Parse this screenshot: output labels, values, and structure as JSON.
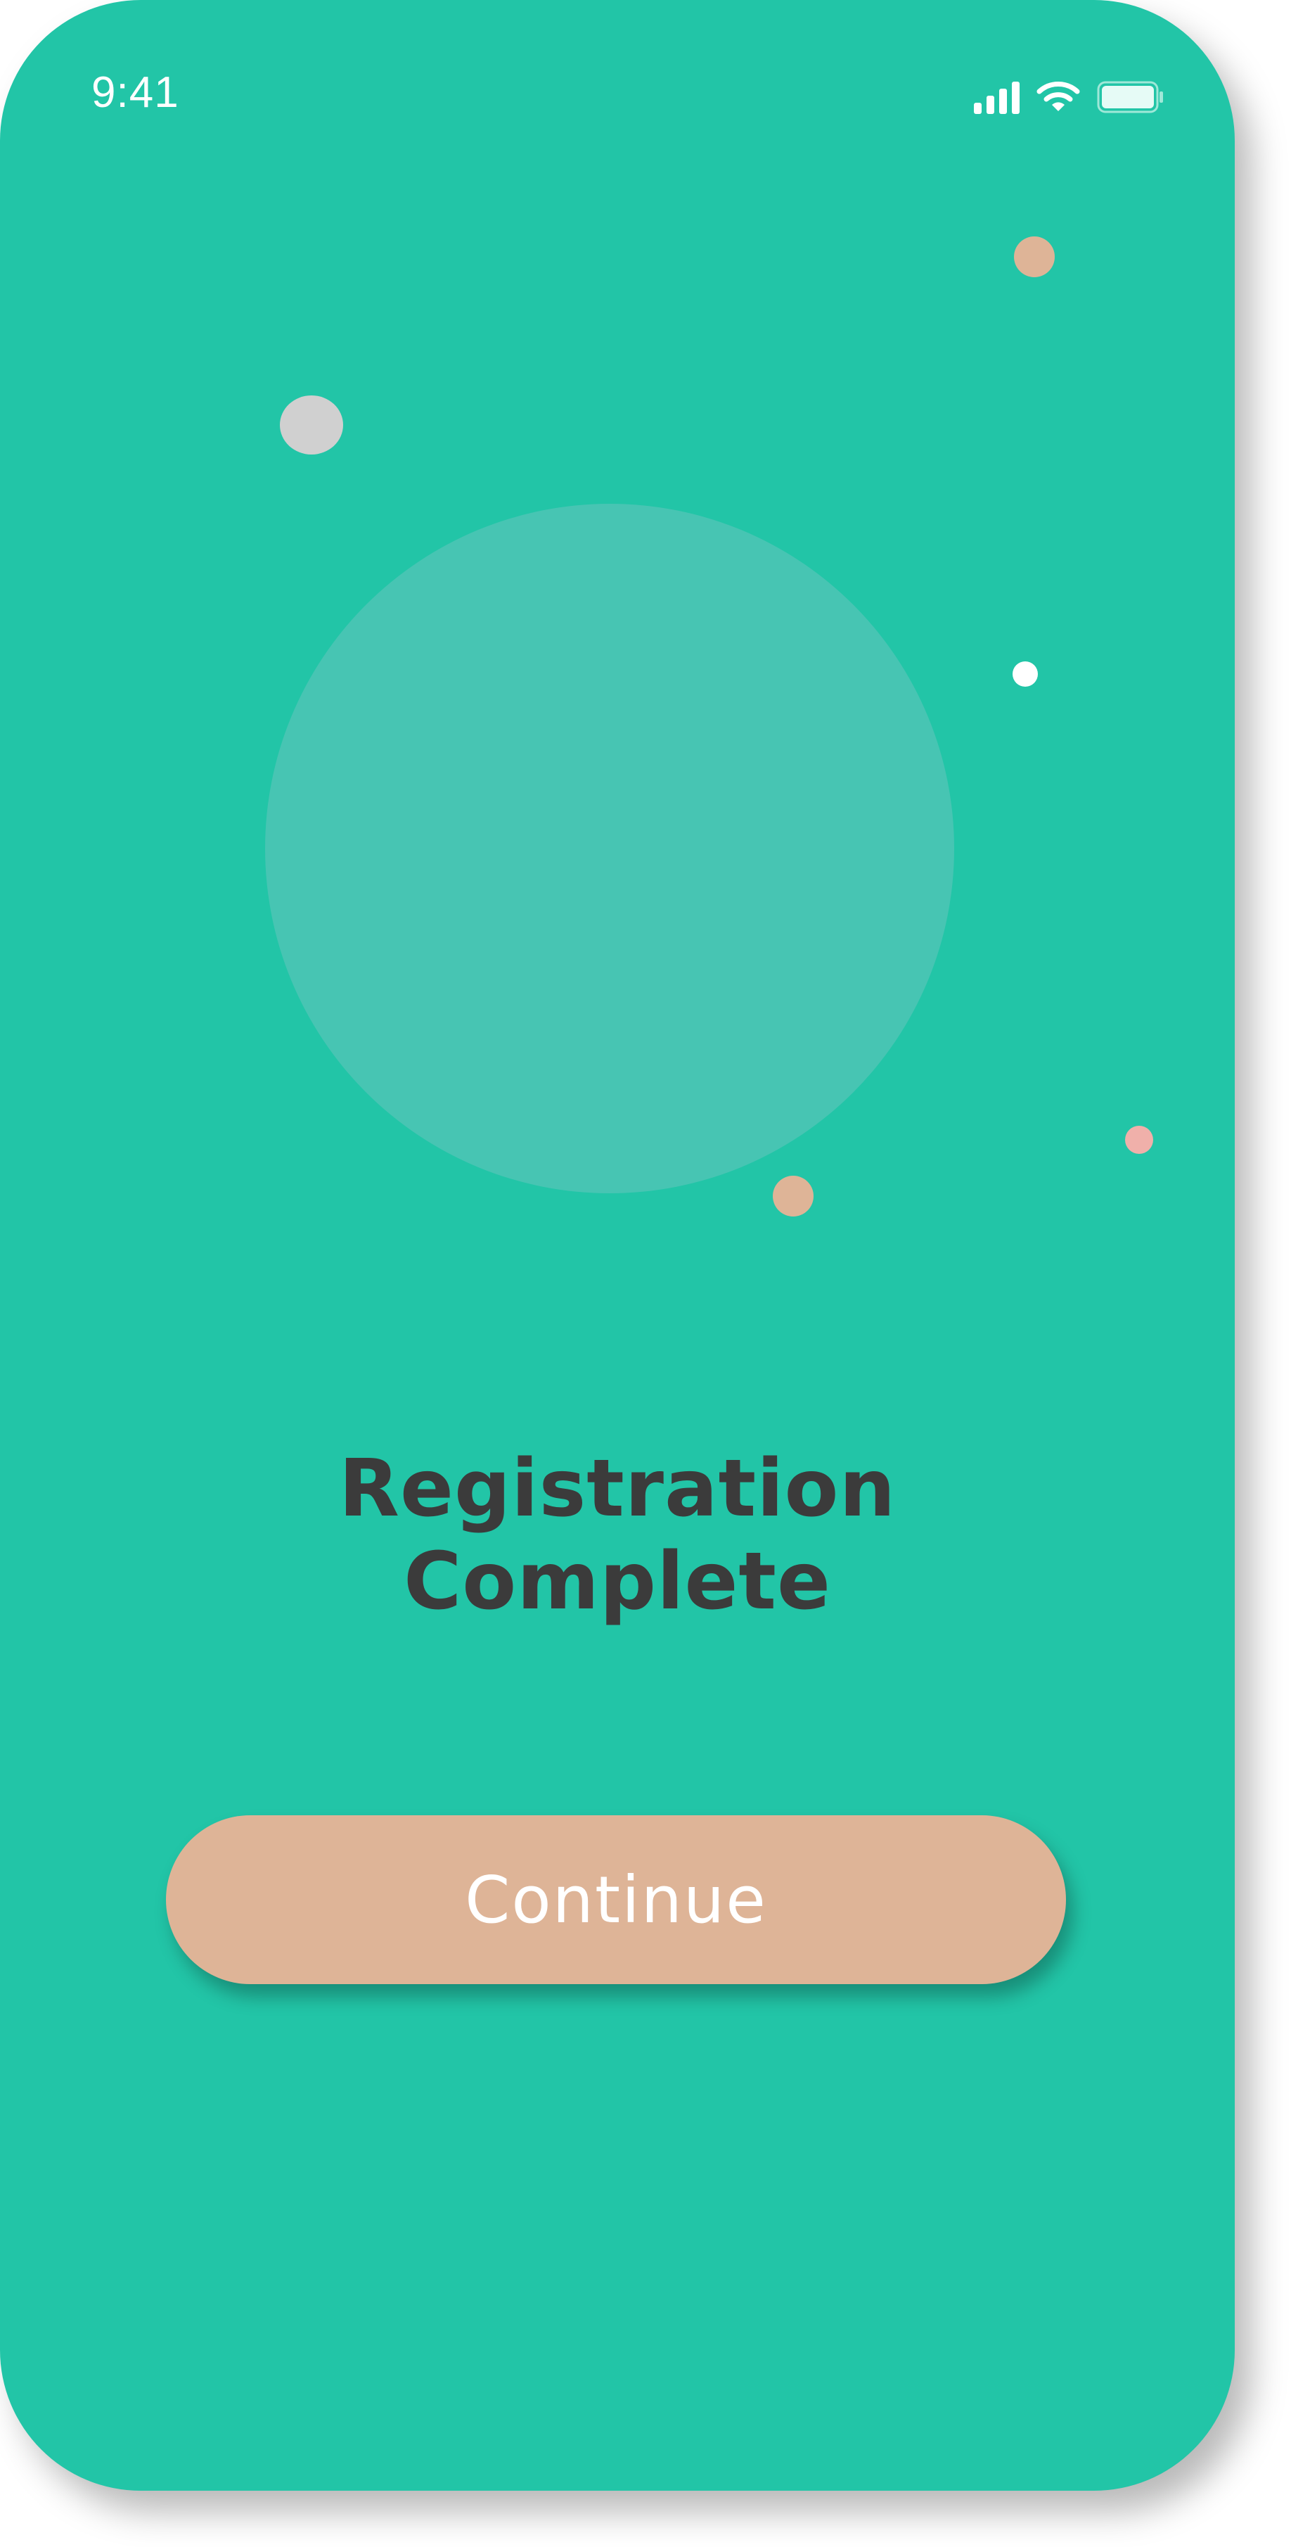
{
  "status_bar": {
    "time": "9:41",
    "icons": [
      "cellular-signal-icon",
      "wifi-icon",
      "battery-icon"
    ]
  },
  "decorations": {
    "colors": {
      "background": "#22c5a7",
      "large_circle": "#47c5b3",
      "peach_dot": "#deb497",
      "gray_dot": "#d0d0d0",
      "white_dot": "#ffffff",
      "pink_dot": "#f0b0aa"
    }
  },
  "content": {
    "title_line1": "Registration",
    "title_line2": "Complete"
  },
  "actions": {
    "continue_label": "Continue",
    "continue_color": "#deb497"
  }
}
